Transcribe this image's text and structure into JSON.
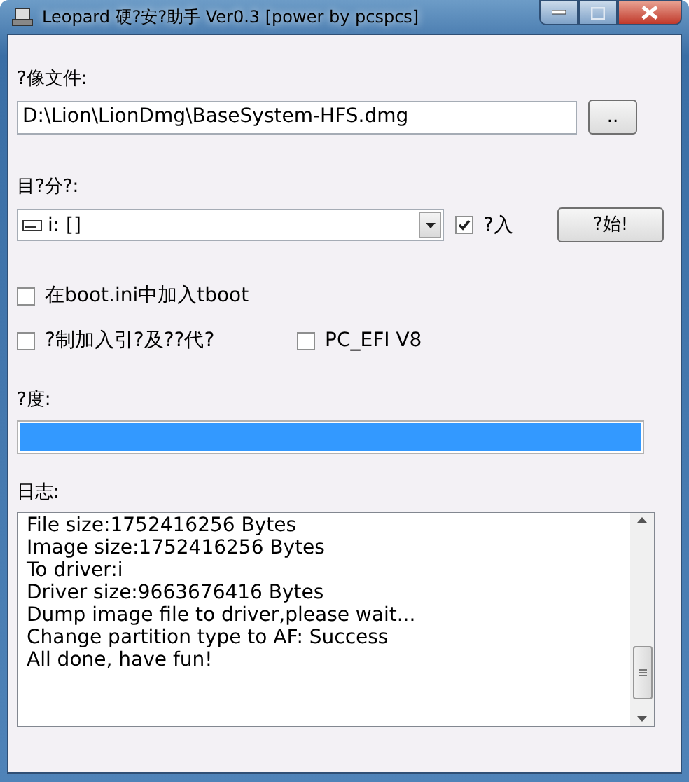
{
  "window": {
    "title": "Leopard 硬?安?助手 Ver0.3 [power by pcspcs]"
  },
  "image_file": {
    "label": "?像文件:",
    "value": "D:\\Lion\\LionDmg\\BaseSystem-HFS.dmg",
    "browse_button": ".."
  },
  "target_partition": {
    "label": "目?分?:",
    "value": "i: []",
    "write_checkbox": {
      "label": "?入",
      "checked": true
    },
    "start_button": "?始!"
  },
  "options": [
    {
      "label": "在boot.ini中加入tboot",
      "checked": false
    },
    {
      "label": "?制加入引?及??代?",
      "checked": false
    },
    {
      "label": "PC_EFI V8",
      "checked": false
    }
  ],
  "progress": {
    "label": "?度:",
    "level": 1
  },
  "log": {
    "label": "日志:",
    "lines": [
      "File size:1752416256 Bytes",
      "Image size:1752416256 Bytes",
      "To driver:i",
      "Driver size:9663676416 Bytes",
      "Dump image file to driver,please wait...",
      "Change partition type to AF: Success",
      "All done, have fun!"
    ]
  }
}
